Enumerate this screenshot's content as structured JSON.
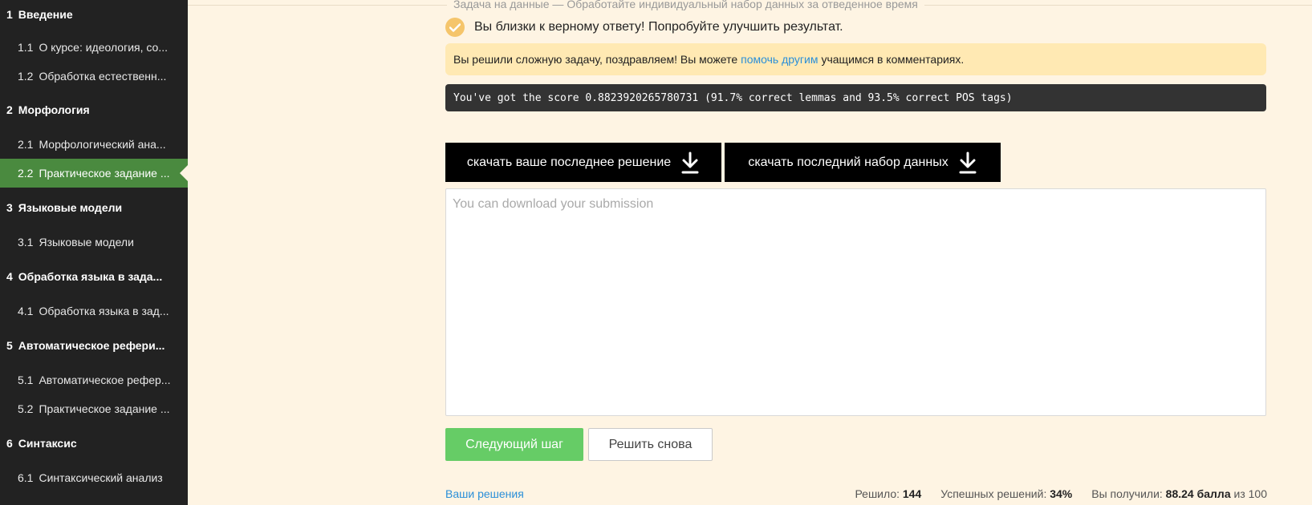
{
  "sidebar": {
    "items": [
      {
        "num": "1",
        "label": "Введение",
        "type": "section"
      },
      {
        "num": "1.1",
        "label": "О курсе: идеология, со...",
        "type": "lesson"
      },
      {
        "num": "1.2",
        "label": "Обработка естественн...",
        "type": "lesson"
      },
      {
        "num": "2",
        "label": "Морфология",
        "type": "section"
      },
      {
        "num": "2.1",
        "label": "Морфологический ана...",
        "type": "lesson"
      },
      {
        "num": "2.2",
        "label": "Практическое задание ...",
        "type": "lesson",
        "active": true
      },
      {
        "num": "3",
        "label": "Языковые модели",
        "type": "section"
      },
      {
        "num": "3.1",
        "label": "Языковые модели",
        "type": "lesson"
      },
      {
        "num": "4",
        "label": "Обработка языка в зада...",
        "type": "section"
      },
      {
        "num": "4.1",
        "label": "Обработка языка в зад...",
        "type": "lesson"
      },
      {
        "num": "5",
        "label": "Автоматическое рефери...",
        "type": "section"
      },
      {
        "num": "5.1",
        "label": "Автоматическое рефер...",
        "type": "lesson"
      },
      {
        "num": "5.2",
        "label": "Практическое задание ...",
        "type": "lesson"
      },
      {
        "num": "6",
        "label": "Синтаксис",
        "type": "section"
      },
      {
        "num": "6.1",
        "label": "Синтаксический анализ",
        "type": "lesson"
      }
    ]
  },
  "task": {
    "legend": "Задача на данные — Обработайте индивидуальный набор данных за отведенное время",
    "status": "Вы близки к верному ответу! Попробуйте улучшить результат.",
    "note_prefix": "Вы решили сложную задачу, поздравляем! Вы можете",
    "note_link": "помочь другим",
    "note_suffix": "учащимся в комментариях.",
    "score": "You've got the score 0.8823920265780731 (91.7% correct lemmas and 93.5% correct POS tags)",
    "download_solution": "скачать ваше последнее решение",
    "download_dataset": "скачать последний набор данных",
    "textarea_placeholder": "You can download your submission",
    "next_button": "Следующий шаг",
    "retry_button": "Решить снова"
  },
  "footer": {
    "solutions_link": "Ваши решения",
    "solved_label": "Решило:",
    "solved_value": "144",
    "success_label": "Успешных решений:",
    "success_value": "34%",
    "got_label": "Вы получили:",
    "got_value": "88.24 балла",
    "got_suffix": "из 100"
  },
  "colors": {
    "sidebar_bg": "#222222",
    "active_item": "#4a8a3f",
    "page_bg": "#fef4e3",
    "check_circle": "#f5c56b",
    "note_bg": "#ffe9b3",
    "link": "#2a8fd8",
    "next_button": "#66cc66"
  }
}
